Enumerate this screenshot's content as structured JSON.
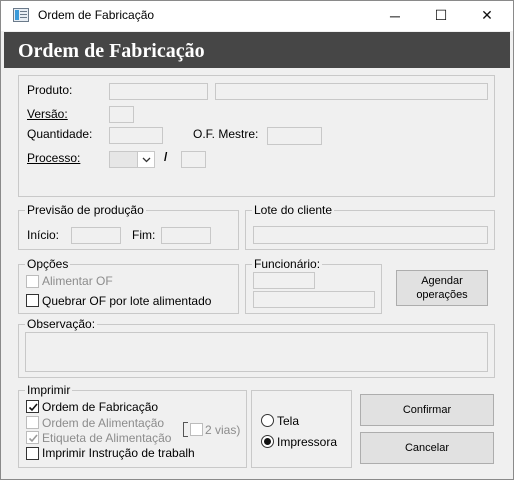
{
  "window": {
    "title": "Ordem de Fabricação",
    "minimize_glyph": "─",
    "maximize_glyph": "☐",
    "close_glyph": "✕"
  },
  "header": {
    "title": "Ordem de Fabricação"
  },
  "produto_section": {
    "produto_label": "Produto:",
    "versao_label": "Versão:",
    "quantidade_label": "Quantidade:",
    "of_mestre_label": "O.F. Mestre:",
    "processo_label": "Processo:",
    "processo_separator": "/"
  },
  "previsao": {
    "group_label": "Previsão de produção",
    "inicio_label": "Início:",
    "fim_label": "Fim:"
  },
  "lote": {
    "group_label": "Lote do cliente"
  },
  "opcoes": {
    "group_label": "Opções",
    "alimentar_of_label": "Alimentar OF",
    "quebrar_of_label": "Quebrar OF por lote alimentado"
  },
  "funcionario": {
    "group_label": "Funcionário:"
  },
  "agendar_button": "Agendar operações",
  "observacao": {
    "group_label": "Observação:"
  },
  "imprimir": {
    "group_label": "Imprimir",
    "ordem_fabricacao_label": "Ordem de Fabricação",
    "ordem_alimentacao_label": "Ordem de Alimentação",
    "etiqueta_alimentacao_label": "Etiqueta de Alimentação",
    "duas_vias_label": "2 vias)",
    "instrucao_label": "Imprimir Instrução de trabalh"
  },
  "output": {
    "tela_label": "Tela",
    "impressora_label": "Impressora"
  },
  "confirmar_button": "Confirmar",
  "cancelar_button": "Cancelar"
}
